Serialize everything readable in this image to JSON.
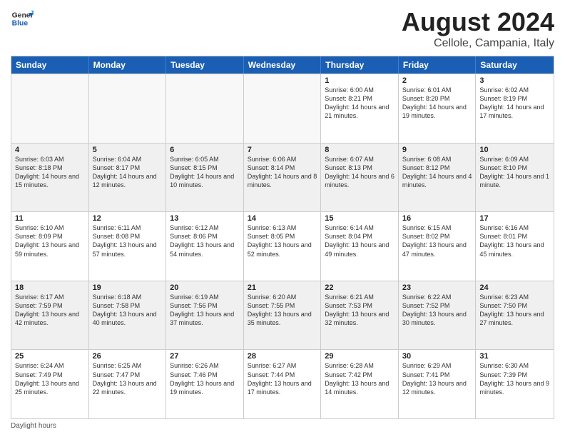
{
  "logo": {
    "line1": "General",
    "line2": "Blue"
  },
  "title": "August 2024",
  "subtitle": "Cellole, Campania, Italy",
  "header_days": [
    "Sunday",
    "Monday",
    "Tuesday",
    "Wednesday",
    "Thursday",
    "Friday",
    "Saturday"
  ],
  "rows": [
    [
      {
        "day": "",
        "info": ""
      },
      {
        "day": "",
        "info": ""
      },
      {
        "day": "",
        "info": ""
      },
      {
        "day": "",
        "info": ""
      },
      {
        "day": "1",
        "info": "Sunrise: 6:00 AM\nSunset: 8:21 PM\nDaylight: 14 hours and 21 minutes."
      },
      {
        "day": "2",
        "info": "Sunrise: 6:01 AM\nSunset: 8:20 PM\nDaylight: 14 hours and 19 minutes."
      },
      {
        "day": "3",
        "info": "Sunrise: 6:02 AM\nSunset: 8:19 PM\nDaylight: 14 hours and 17 minutes."
      }
    ],
    [
      {
        "day": "4",
        "info": "Sunrise: 6:03 AM\nSunset: 8:18 PM\nDaylight: 14 hours and 15 minutes."
      },
      {
        "day": "5",
        "info": "Sunrise: 6:04 AM\nSunset: 8:17 PM\nDaylight: 14 hours and 12 minutes."
      },
      {
        "day": "6",
        "info": "Sunrise: 6:05 AM\nSunset: 8:15 PM\nDaylight: 14 hours and 10 minutes."
      },
      {
        "day": "7",
        "info": "Sunrise: 6:06 AM\nSunset: 8:14 PM\nDaylight: 14 hours and 8 minutes."
      },
      {
        "day": "8",
        "info": "Sunrise: 6:07 AM\nSunset: 8:13 PM\nDaylight: 14 hours and 6 minutes."
      },
      {
        "day": "9",
        "info": "Sunrise: 6:08 AM\nSunset: 8:12 PM\nDaylight: 14 hours and 4 minutes."
      },
      {
        "day": "10",
        "info": "Sunrise: 6:09 AM\nSunset: 8:10 PM\nDaylight: 14 hours and 1 minute."
      }
    ],
    [
      {
        "day": "11",
        "info": "Sunrise: 6:10 AM\nSunset: 8:09 PM\nDaylight: 13 hours and 59 minutes."
      },
      {
        "day": "12",
        "info": "Sunrise: 6:11 AM\nSunset: 8:08 PM\nDaylight: 13 hours and 57 minutes."
      },
      {
        "day": "13",
        "info": "Sunrise: 6:12 AM\nSunset: 8:06 PM\nDaylight: 13 hours and 54 minutes."
      },
      {
        "day": "14",
        "info": "Sunrise: 6:13 AM\nSunset: 8:05 PM\nDaylight: 13 hours and 52 minutes."
      },
      {
        "day": "15",
        "info": "Sunrise: 6:14 AM\nSunset: 8:04 PM\nDaylight: 13 hours and 49 minutes."
      },
      {
        "day": "16",
        "info": "Sunrise: 6:15 AM\nSunset: 8:02 PM\nDaylight: 13 hours and 47 minutes."
      },
      {
        "day": "17",
        "info": "Sunrise: 6:16 AM\nSunset: 8:01 PM\nDaylight: 13 hours and 45 minutes."
      }
    ],
    [
      {
        "day": "18",
        "info": "Sunrise: 6:17 AM\nSunset: 7:59 PM\nDaylight: 13 hours and 42 minutes."
      },
      {
        "day": "19",
        "info": "Sunrise: 6:18 AM\nSunset: 7:58 PM\nDaylight: 13 hours and 40 minutes."
      },
      {
        "day": "20",
        "info": "Sunrise: 6:19 AM\nSunset: 7:56 PM\nDaylight: 13 hours and 37 minutes."
      },
      {
        "day": "21",
        "info": "Sunrise: 6:20 AM\nSunset: 7:55 PM\nDaylight: 13 hours and 35 minutes."
      },
      {
        "day": "22",
        "info": "Sunrise: 6:21 AM\nSunset: 7:53 PM\nDaylight: 13 hours and 32 minutes."
      },
      {
        "day": "23",
        "info": "Sunrise: 6:22 AM\nSunset: 7:52 PM\nDaylight: 13 hours and 30 minutes."
      },
      {
        "day": "24",
        "info": "Sunrise: 6:23 AM\nSunset: 7:50 PM\nDaylight: 13 hours and 27 minutes."
      }
    ],
    [
      {
        "day": "25",
        "info": "Sunrise: 6:24 AM\nSunset: 7:49 PM\nDaylight: 13 hours and 25 minutes."
      },
      {
        "day": "26",
        "info": "Sunrise: 6:25 AM\nSunset: 7:47 PM\nDaylight: 13 hours and 22 minutes."
      },
      {
        "day": "27",
        "info": "Sunrise: 6:26 AM\nSunset: 7:46 PM\nDaylight: 13 hours and 19 minutes."
      },
      {
        "day": "28",
        "info": "Sunrise: 6:27 AM\nSunset: 7:44 PM\nDaylight: 13 hours and 17 minutes."
      },
      {
        "day": "29",
        "info": "Sunrise: 6:28 AM\nSunset: 7:42 PM\nDaylight: 13 hours and 14 minutes."
      },
      {
        "day": "30",
        "info": "Sunrise: 6:29 AM\nSunset: 7:41 PM\nDaylight: 13 hours and 12 minutes."
      },
      {
        "day": "31",
        "info": "Sunrise: 6:30 AM\nSunset: 7:39 PM\nDaylight: 13 hours and 9 minutes."
      }
    ]
  ],
  "footer": "Daylight hours"
}
